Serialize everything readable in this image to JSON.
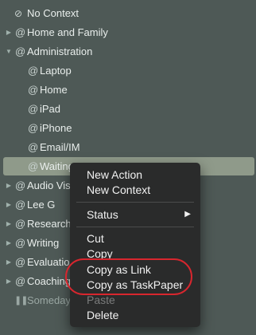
{
  "sidebar": {
    "no_context": "No Context",
    "home_family": "Home and Family",
    "administration": "Administration",
    "laptop": "Laptop",
    "home": "Home",
    "ipad": "iPad",
    "iphone": "iPhone",
    "email": "Email/IM",
    "waiting": "Waiting F",
    "audio": "Audio Vis",
    "leeg": "Lee G",
    "research": "Research",
    "writing": "Writing",
    "evaluation": "Evaluation",
    "coaching": "Coaching",
    "someday": "Someday"
  },
  "context_menu": {
    "new_action": "New Action",
    "new_context": "New Context",
    "status": "Status",
    "cut": "Cut",
    "copy": "Copy",
    "copy_as_link": "Copy as Link",
    "copy_as_taskpaper": "Copy as TaskPaper",
    "paste": "Paste",
    "delete": "Delete"
  },
  "colors": {
    "background": "#4e5956",
    "selection": "#8f9a8a",
    "menu": "#2a2b2b",
    "highlight_circle": "#d8262e"
  }
}
